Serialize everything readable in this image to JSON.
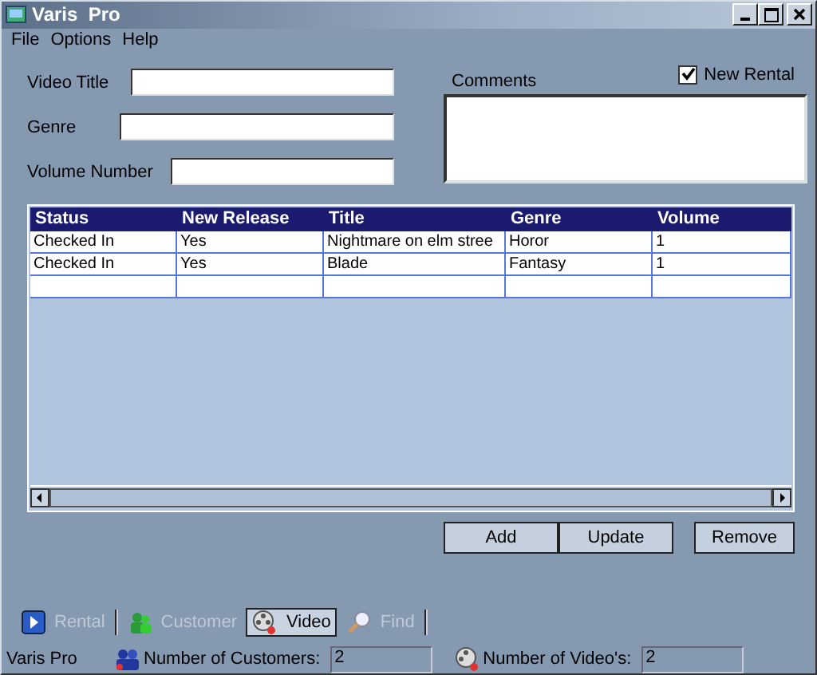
{
  "window": {
    "title": "Varis  Pro"
  },
  "menu": [
    "File",
    "Options",
    "Help"
  ],
  "form": {
    "fields": [
      {
        "label": "Video Title"
      },
      {
        "label": "Genre"
      },
      {
        "label": "Volume Number"
      }
    ],
    "comments_label": "Comments",
    "new_rental": {
      "label": "New Rental",
      "checked": true
    }
  },
  "table": {
    "columns": [
      "Status",
      "New Release",
      "Title",
      "Genre",
      "Volume"
    ],
    "rows": [
      [
        "Checked In",
        "Yes",
        "Nightmare on elm stree",
        "Horor",
        "1"
      ],
      [
        "Checked In",
        "Yes",
        "Blade",
        "Fantasy",
        "1"
      ],
      [
        "",
        "",
        "",
        "",
        ""
      ]
    ]
  },
  "buttons": [
    "Add",
    "Update",
    "Remove"
  ],
  "toolbar": [
    {
      "label": "Rental",
      "selected": false,
      "kind": "rental"
    },
    {
      "label": "Customer",
      "selected": false,
      "kind": "customer"
    },
    {
      "label": "Video",
      "selected": true,
      "kind": "video"
    },
    {
      "label": "Find",
      "selected": false,
      "kind": "find"
    }
  ],
  "status_bar": {
    "app": "Varis Pro",
    "customers_label": "Number of Customers:",
    "customers": "2",
    "videos_label": "Number of Video's:",
    "videos": "2"
  }
}
